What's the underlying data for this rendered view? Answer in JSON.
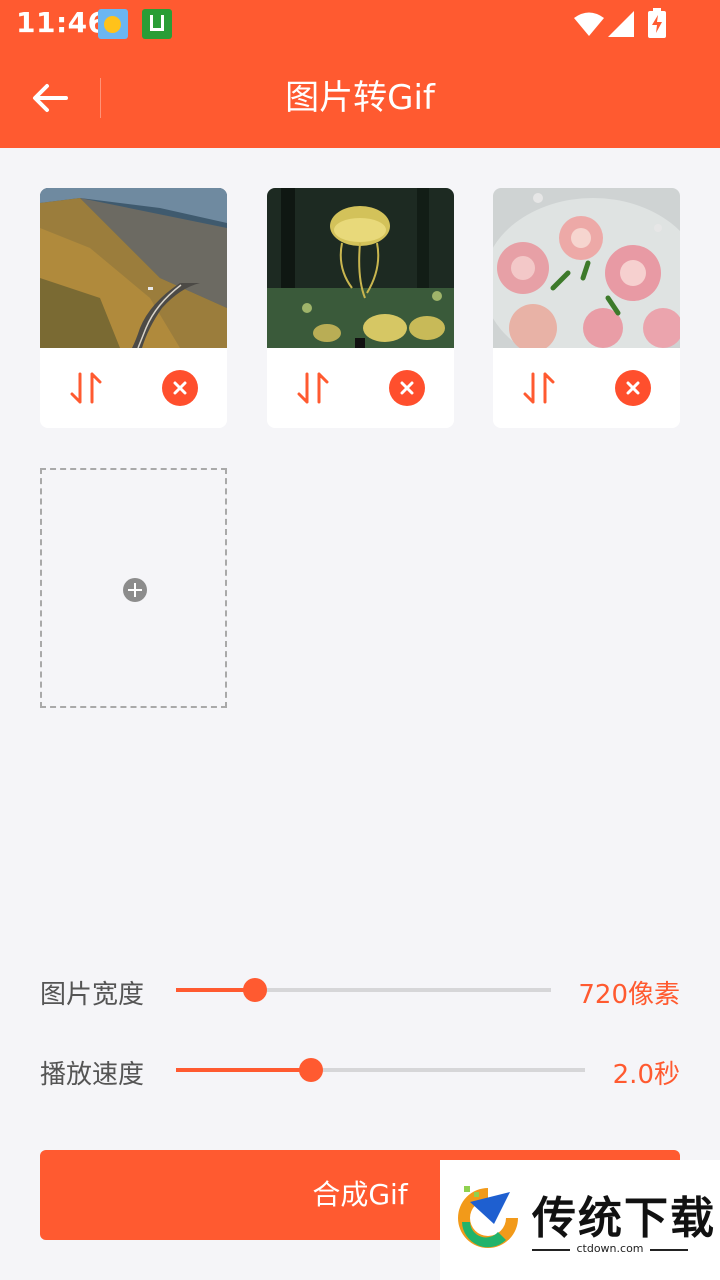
{
  "status_bar": {
    "time": "11:46"
  },
  "app_bar": {
    "title": "图片转Gif"
  },
  "images": [
    {
      "name": "mountain road"
    },
    {
      "name": "jellyfish forest"
    },
    {
      "name": "flowers in bowl"
    }
  ],
  "settings": {
    "width": {
      "label": "图片宽度",
      "value_text": "720像素",
      "fraction": 0.21
    },
    "speed": {
      "label": "播放速度",
      "value_text": "2.0秒",
      "fraction": 0.33
    }
  },
  "generate_button": {
    "label": "合成Gif"
  },
  "watermark": {
    "brand": "传统下载",
    "site": "ctdown.com"
  },
  "colors": {
    "accent": "#ff5a30",
    "delete": "#ff4f2d",
    "background": "#f5f5f8"
  }
}
